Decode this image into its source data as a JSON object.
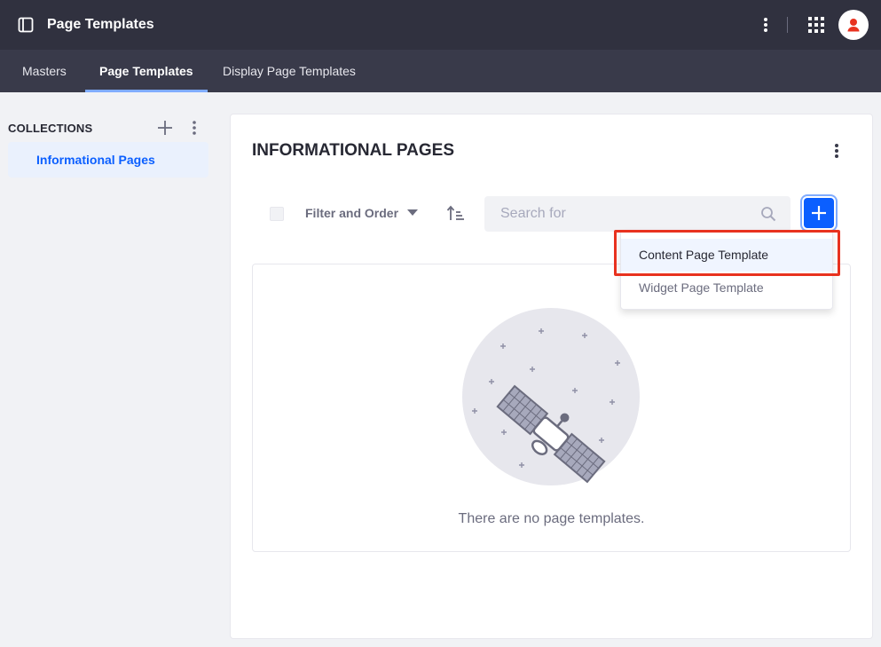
{
  "header": {
    "title": "Page Templates",
    "icons": {
      "panel": "product-menu-icon",
      "kebab": "ellipsis-v-icon",
      "apps": "apps-grid-icon",
      "avatar": "user-avatar-icon"
    },
    "colors": {
      "background": "#30313f",
      "avatar_accent": "#e8321f"
    }
  },
  "nav": {
    "tabs": [
      {
        "label": "Masters",
        "active": false
      },
      {
        "label": "Page Templates",
        "active": true
      },
      {
        "label": "Display Page Templates",
        "active": false
      }
    ],
    "colors": {
      "background": "#393a4a",
      "active_indicator": "#80acff"
    }
  },
  "sidebar": {
    "title": "COLLECTIONS",
    "items": [
      {
        "label": "Informational Pages",
        "selected": true
      }
    ]
  },
  "main": {
    "heading": "INFORMATIONAL PAGES",
    "toolbar": {
      "filter_label": "Filter and Order",
      "search_placeholder": "Search for"
    },
    "add_menu": {
      "items": [
        {
          "label": "Content Page Template",
          "highlighted": true
        },
        {
          "label": "Widget Page Template",
          "highlighted": false
        }
      ]
    },
    "empty_state": {
      "message": "There are no page templates."
    }
  },
  "colors": {
    "primary": "#0b5fff",
    "highlight_outline": "#e8321f",
    "text": "#272833",
    "secondary_text": "#6b6c7e"
  }
}
